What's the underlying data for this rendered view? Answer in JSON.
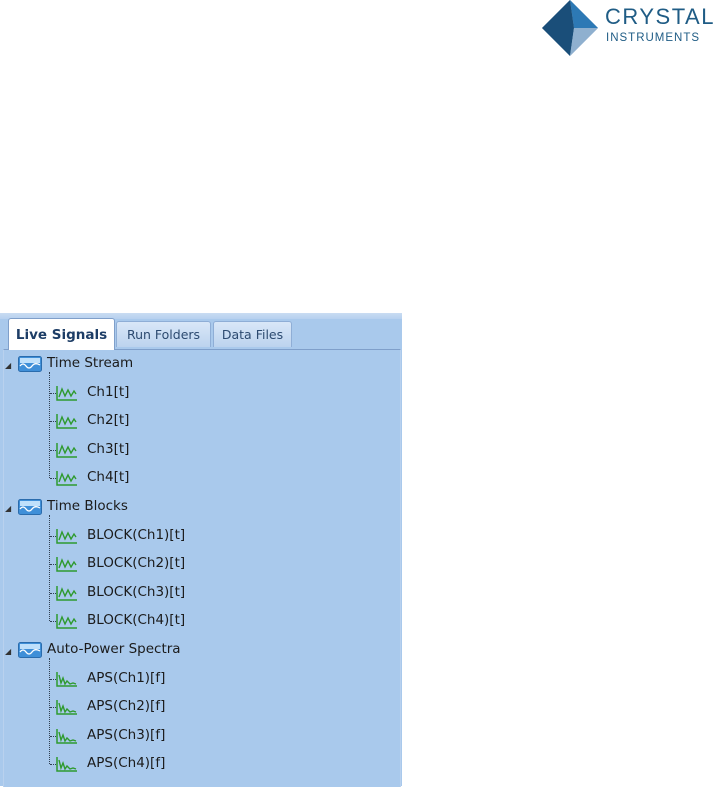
{
  "logo": {
    "brand": "CRYSTAL",
    "sub": "INSTRUMENTS",
    "colors": {
      "dark": "#1a4e79",
      "light": "#2d79b5",
      "pale": "#a7bfd6"
    }
  },
  "panel": {
    "tabs": [
      {
        "label": "Live Signals",
        "active": true
      },
      {
        "label": "Run Folders",
        "active": false
      },
      {
        "label": "Data Files",
        "active": false
      }
    ],
    "tree": [
      {
        "label": "Time Stream",
        "expanded": true,
        "icon": "signal-group-icon",
        "children": [
          {
            "label": "Ch1[t]",
            "icon": "time-signal-icon"
          },
          {
            "label": "Ch2[t]",
            "icon": "time-signal-icon"
          },
          {
            "label": "Ch3[t]",
            "icon": "time-signal-icon"
          },
          {
            "label": "Ch4[t]",
            "icon": "time-signal-icon"
          }
        ]
      },
      {
        "label": "Time Blocks",
        "expanded": true,
        "icon": "signal-group-icon",
        "children": [
          {
            "label": "BLOCK(Ch1)[t]",
            "icon": "time-signal-icon"
          },
          {
            "label": "BLOCK(Ch2)[t]",
            "icon": "time-signal-icon"
          },
          {
            "label": "BLOCK(Ch3)[t]",
            "icon": "time-signal-icon"
          },
          {
            "label": "BLOCK(Ch4)[t]",
            "icon": "time-signal-icon"
          }
        ]
      },
      {
        "label": "Auto-Power Spectra",
        "expanded": true,
        "icon": "signal-group-icon",
        "children": [
          {
            "label": "APS(Ch1)[f]",
            "icon": "spectrum-signal-icon"
          },
          {
            "label": "APS(Ch2)[f]",
            "icon": "spectrum-signal-icon"
          },
          {
            "label": "APS(Ch3)[f]",
            "icon": "spectrum-signal-icon"
          },
          {
            "label": "APS(Ch4)[f]",
            "icon": "spectrum-signal-icon"
          }
        ]
      }
    ]
  },
  "colors": {
    "panel_bg": "#a9c9ec",
    "signal_green": "#2e9a2e",
    "group_icon_blue": "#3f8fd8"
  }
}
